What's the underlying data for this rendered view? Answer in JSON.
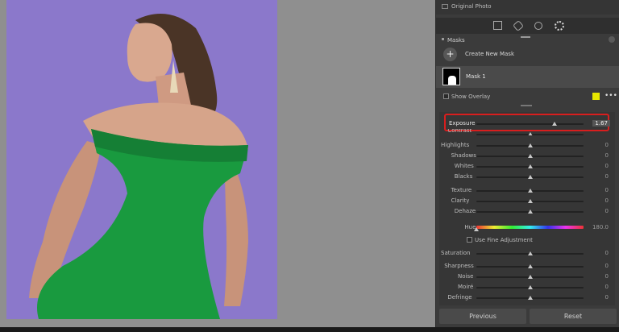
{
  "window": {
    "accent_color": "#d81e1e"
  },
  "panel": {
    "original_photo_label": "Original Photo",
    "tools": [
      "crop-icon",
      "heal-icon",
      "redeye-icon",
      "masking-icon"
    ],
    "masks_title": "Masks",
    "create_mask_label": "Create New Mask",
    "mask_item_label": "Mask 1",
    "show_overlay_label": "Show Overlay",
    "overlay_color": "#e6e600",
    "use_fine_adjustment_label": "Use Fine Adjustment",
    "sliders": [
      {
        "label": "Exposure",
        "value": "1.67",
        "pos": 0.73,
        "highlight": true
      },
      {
        "label": "Contrast",
        "value": "",
        "pos": 0.5,
        "partial": true
      },
      {
        "label": "Highlights",
        "value": "0",
        "pos": 0.5
      },
      {
        "label": "Shadows",
        "value": "0",
        "pos": 0.5
      },
      {
        "label": "Whites",
        "value": "0",
        "pos": 0.5
      },
      {
        "label": "Blacks",
        "value": "0",
        "pos": 0.5
      },
      {
        "label": "Texture",
        "value": "0",
        "pos": 0.5
      },
      {
        "label": "Clarity",
        "value": "0",
        "pos": 0.5
      },
      {
        "label": "Dehaze",
        "value": "0",
        "pos": 0.5
      },
      {
        "label": "Hue",
        "value": "180.0",
        "pos": 0.0,
        "hue": true
      },
      {
        "label": "Saturation",
        "value": "0",
        "pos": 0.5
      },
      {
        "label": "Sharpness",
        "value": "0",
        "pos": 0.5
      },
      {
        "label": "Noise",
        "value": "0",
        "pos": 0.5
      },
      {
        "label": "Moiré",
        "value": "0",
        "pos": 0.5
      },
      {
        "label": "Defringe",
        "value": "0",
        "pos": 0.5
      }
    ],
    "buttons": {
      "previous": "Previous",
      "reset": "Reset"
    }
  }
}
